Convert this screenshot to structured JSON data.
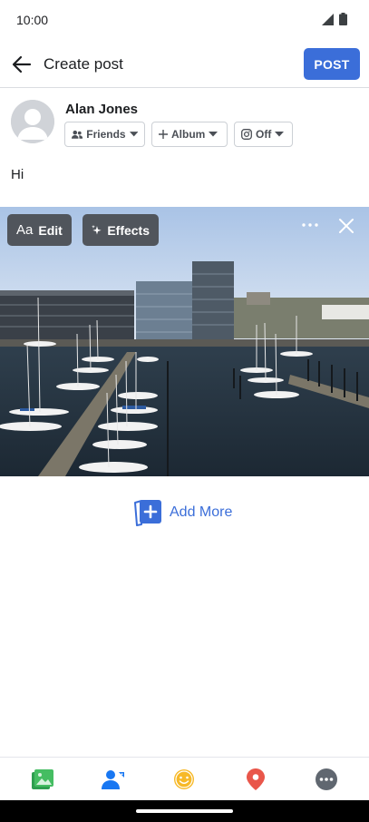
{
  "status": {
    "time": "10:00"
  },
  "header": {
    "title": "Create post",
    "post_label": "POST"
  },
  "author": {
    "name": "Alan Jones",
    "audience_label": "Friends",
    "album_label": "Album",
    "instagram_label": "Off"
  },
  "post": {
    "text": "Hi"
  },
  "photo": {
    "edit_prefix": "Aa",
    "edit_label": "Edit",
    "effects_label": "Effects"
  },
  "add_more": {
    "label": "Add More"
  },
  "bottom_bar": {
    "icons": [
      "photo-icon",
      "tag-people-icon",
      "feeling-icon",
      "location-icon",
      "more-icon"
    ]
  },
  "colors": {
    "accent": "#3b6ed9",
    "photo_green": "#45bd62",
    "people_blue": "#1877f2",
    "feeling_yellow": "#f7b928",
    "location_red": "#e9564a",
    "more_gray": "#606770"
  }
}
